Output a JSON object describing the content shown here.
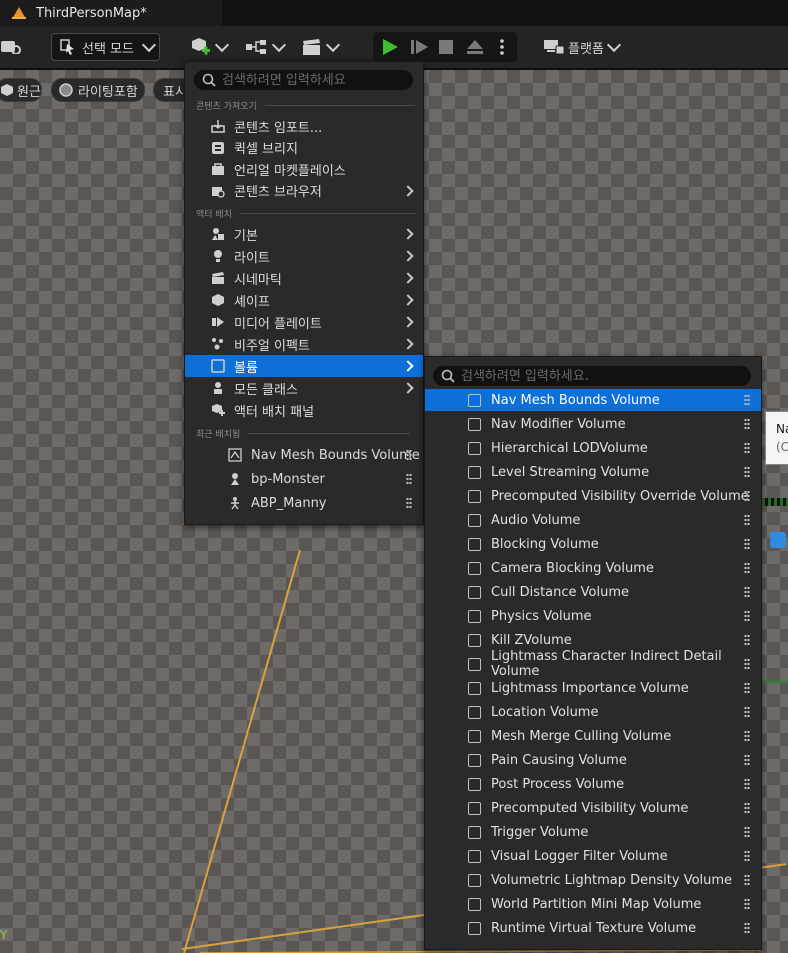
{
  "window": {
    "tab_title": "ThirdPersonMap*"
  },
  "toolbar": {
    "mode_label": "선택 모드",
    "platform_label": "플랫폼"
  },
  "viewport": {
    "pills": [
      "원근",
      "라이팅포함",
      "표시"
    ],
    "axis_label": "Y",
    "tooltip": {
      "line1": "Na",
      "line2": "(C"
    }
  },
  "place_menu": {
    "search_placeholder": "검색하려면 입력하세요",
    "sections": {
      "content": "콘텐츠 가져오기",
      "actors": "액터 배치",
      "recent": "최근 배치됨"
    },
    "content_items": [
      {
        "label": "콘텐츠 임포트...",
        "icon": "import-icon",
        "arrow": false
      },
      {
        "label": "퀵셀 브리지",
        "icon": "bridge-icon",
        "arrow": false
      },
      {
        "label": "언리얼 마켓플레이스",
        "icon": "marketplace-icon",
        "arrow": false
      },
      {
        "label": "콘텐츠 브라우저",
        "icon": "content-browser-icon",
        "arrow": true
      }
    ],
    "actor_items": [
      {
        "label": "기본",
        "icon": "basic-icon",
        "arrow": true
      },
      {
        "label": "라이트",
        "icon": "light-icon",
        "arrow": true
      },
      {
        "label": "시네마틱",
        "icon": "cinematic-icon",
        "arrow": true
      },
      {
        "label": "셰이프",
        "icon": "shape-icon",
        "arrow": true
      },
      {
        "label": "미디어 플레이트",
        "icon": "media-plate-icon",
        "arrow": true
      },
      {
        "label": "비주얼 이펙트",
        "icon": "visual-effects-icon",
        "arrow": true
      },
      {
        "label": "볼륨",
        "icon": "volume-icon",
        "arrow": true,
        "selected": true
      },
      {
        "label": "모든 클래스",
        "icon": "all-classes-icon",
        "arrow": true
      },
      {
        "label": "액터 배치 패널",
        "icon": "place-actors-panel-icon",
        "arrow": false
      }
    ],
    "recent_items": [
      {
        "label": "Nav Mesh Bounds Volume",
        "icon": "nav-mesh-icon"
      },
      {
        "label": "bp-Monster",
        "icon": "pawn-icon"
      },
      {
        "label": "ABP_Manny",
        "icon": "anim-blueprint-icon"
      }
    ]
  },
  "volume_menu": {
    "search_placeholder": "검색하려면 입력하세요.",
    "items": [
      "Nav Mesh Bounds Volume",
      "Nav Modifier Volume",
      "Hierarchical LODVolume",
      "Level Streaming Volume",
      "Precomputed Visibility Override Volume",
      "Audio Volume",
      "Blocking Volume",
      "Camera Blocking Volume",
      "Cull Distance Volume",
      "Physics Volume",
      "Kill ZVolume",
      "Lightmass Character Indirect Detail Volume",
      "Lightmass Importance Volume",
      "Location Volume",
      "Mesh Merge Culling Volume",
      "Pain Causing Volume",
      "Post Process Volume",
      "Precomputed Visibility Volume",
      "Trigger Volume",
      "Visual Logger Filter Volume",
      "Volumetric Lightmap Density Volume",
      "World Partition Mini Map Volume",
      "Runtime Virtual Texture Volume"
    ],
    "selected_index": 0
  },
  "colors": {
    "accent": "#0d6fd8",
    "play_green": "#3fbf2f",
    "guide_orange": "#d9a23a"
  }
}
